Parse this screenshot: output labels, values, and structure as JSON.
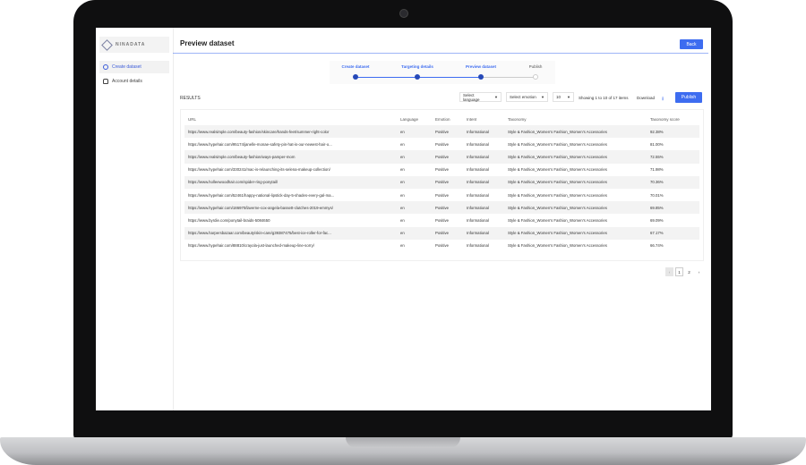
{
  "app": {
    "brand": "NINADATA",
    "sidebar": [
      {
        "label": "Create dataset",
        "icon": "dataset-icon",
        "active": true
      },
      {
        "label": "Account details",
        "icon": "user-icon",
        "active": false
      }
    ]
  },
  "header": {
    "title": "Preview dataset",
    "back_label": "Back"
  },
  "stepper": {
    "steps": [
      {
        "label": "Create dataset",
        "done": true
      },
      {
        "label": "Targeting details",
        "done": true
      },
      {
        "label": "Preview dataset",
        "done": true
      },
      {
        "label": "Publish",
        "done": false
      }
    ]
  },
  "toolbar": {
    "results_label": "RESULTS",
    "language_select": "Select language",
    "emotion_select": "Select emotion",
    "page_size": "10",
    "showing": "Showing 1 to 10 of 17 items",
    "download_label": "Download",
    "publish_label": "Publish"
  },
  "table": {
    "columns": [
      "URL",
      "Language",
      "Emotion",
      "Intent",
      "Taxonomy",
      "Taxonomy score"
    ],
    "rows": [
      [
        "https://www.realsimple.com/beauty-fashion/skincare/hands-feet/summer-right-color",
        "en",
        "Positive",
        "Informational",
        "Style & Fashion_Women's Fashion_Women's Accessories",
        "92.38%"
      ],
      [
        "https://www.hypehair.com/95174/janelle-monae-safety-pin-hat-is-our-newest-hair-o...",
        "en",
        "Positive",
        "Informational",
        "Style & Fashion_Women's Fashion_Women's Accessories",
        "81.00%"
      ],
      [
        "https://www.realsimple.com/beauty-fashion/ways-pamper-mom",
        "en",
        "Positive",
        "Informational",
        "Style & Fashion_Women's Fashion_Women's Accessories",
        "72.55%"
      ],
      [
        "https://www.hypehair.com/330241/mac-is-relaunching-its-selena-makeup-collection/",
        "en",
        "Positive",
        "Informational",
        "Style & Fashion_Women's Fashion_Women's Accessories",
        "71.98%"
      ],
      [
        "https://www.holleewoodhair.com/spider-ring-ponytail/",
        "en",
        "Positive",
        "Informational",
        "Style & Fashion_Women's Fashion_Women's Accessories",
        "70.36%"
      ],
      [
        "https://www.hypehair.com/52461/happy-national-lipstick-day-5-shades-every-gal-ma...",
        "en",
        "Positive",
        "Informational",
        "Style & Fashion_Women's Fashion_Women's Accessories",
        "70.01%"
      ],
      [
        "https://www.hypehair.com/186970/laverne-cox-angela-bassett-clutches-2019-emmys/",
        "en",
        "Positive",
        "Informational",
        "Style & Fashion_Women's Fashion_Women's Accessories",
        "69.85%"
      ],
      [
        "https://www.byrdie.com/ponytail-braids-5084650",
        "en",
        "Positive",
        "Informational",
        "Style & Fashion_Women's Fashion_Women's Accessories",
        "69.09%"
      ],
      [
        "https://www.harpersbazaar.com/beauty/skin-care/g39387475/best-ice-roller-for-fac...",
        "en",
        "Positive",
        "Informational",
        "Style & Fashion_Women's Fashion_Women's Accessories",
        "67.17%"
      ],
      [
        "https://www.hypehair.com/88810/crayola-just-launched-makeup-line-sorry/",
        "en",
        "Positive",
        "Informational",
        "Style & Fashion_Women's Fashion_Women's Accessories",
        "66.74%"
      ]
    ]
  },
  "pagination": {
    "prev": "‹",
    "pages": [
      "1",
      "2"
    ],
    "current": "1",
    "next": "›"
  }
}
